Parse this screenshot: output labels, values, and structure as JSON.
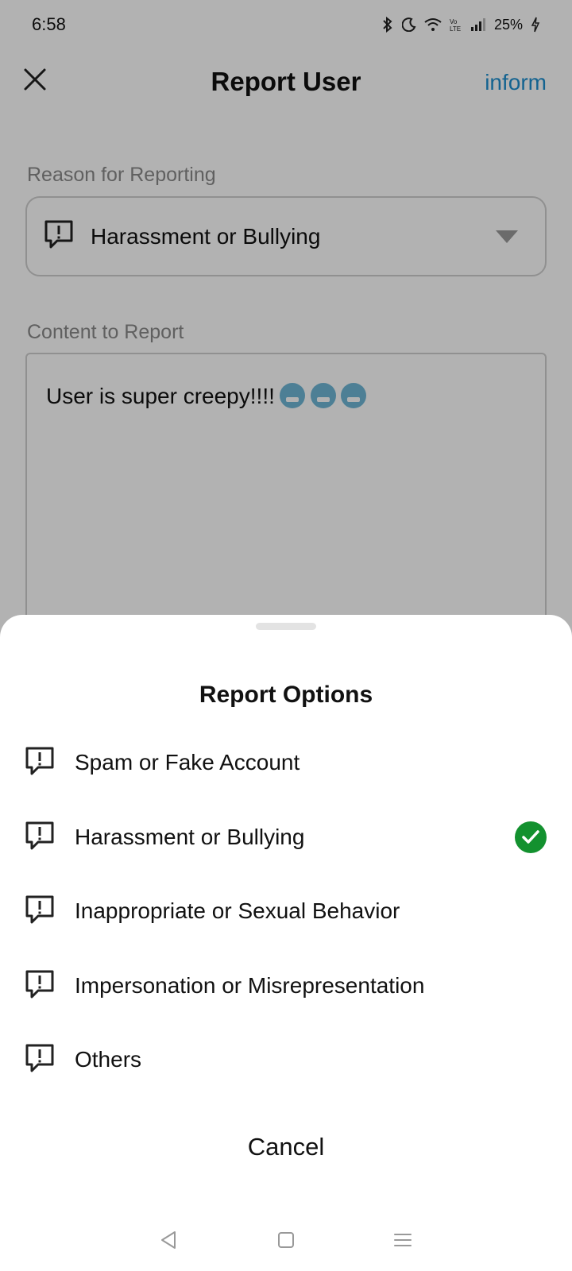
{
  "status_bar": {
    "time": "6:58",
    "battery": "25%",
    "icons": [
      "bluetooth-icon",
      "moon-icon",
      "wifi-icon",
      "volte-icon",
      "signal-icon",
      "battery-icon",
      "charging-icon"
    ]
  },
  "header": {
    "title": "Report User",
    "action_label": "inform",
    "close_icon": "close-icon"
  },
  "form": {
    "reason_label": "Reason for Reporting",
    "reason_value": "Harassment or Bullying",
    "content_label": "Content to Report",
    "content_value": "User is super creepy!!!!"
  },
  "sheet": {
    "title": "Report Options",
    "options": [
      {
        "label": "Spam or Fake Account",
        "selected": false,
        "icon": "report-icon"
      },
      {
        "label": "Harassment or Bullying",
        "selected": true,
        "icon": "report-icon"
      },
      {
        "label": "Inappropriate or Sexual Behavior",
        "selected": false,
        "icon": "report-icon"
      },
      {
        "label": "Impersonation or Misrepresentation",
        "selected": false,
        "icon": "report-icon"
      },
      {
        "label": "Others",
        "selected": false,
        "icon": "report-icon"
      }
    ],
    "cancel_label": "Cancel"
  },
  "colors": {
    "accent": "#1e8fcf",
    "check": "#13912f",
    "overlay": "rgba(0,0,0,0.30)"
  },
  "nav": {
    "icons": [
      "back-icon",
      "home-icon",
      "menu-icon"
    ]
  }
}
